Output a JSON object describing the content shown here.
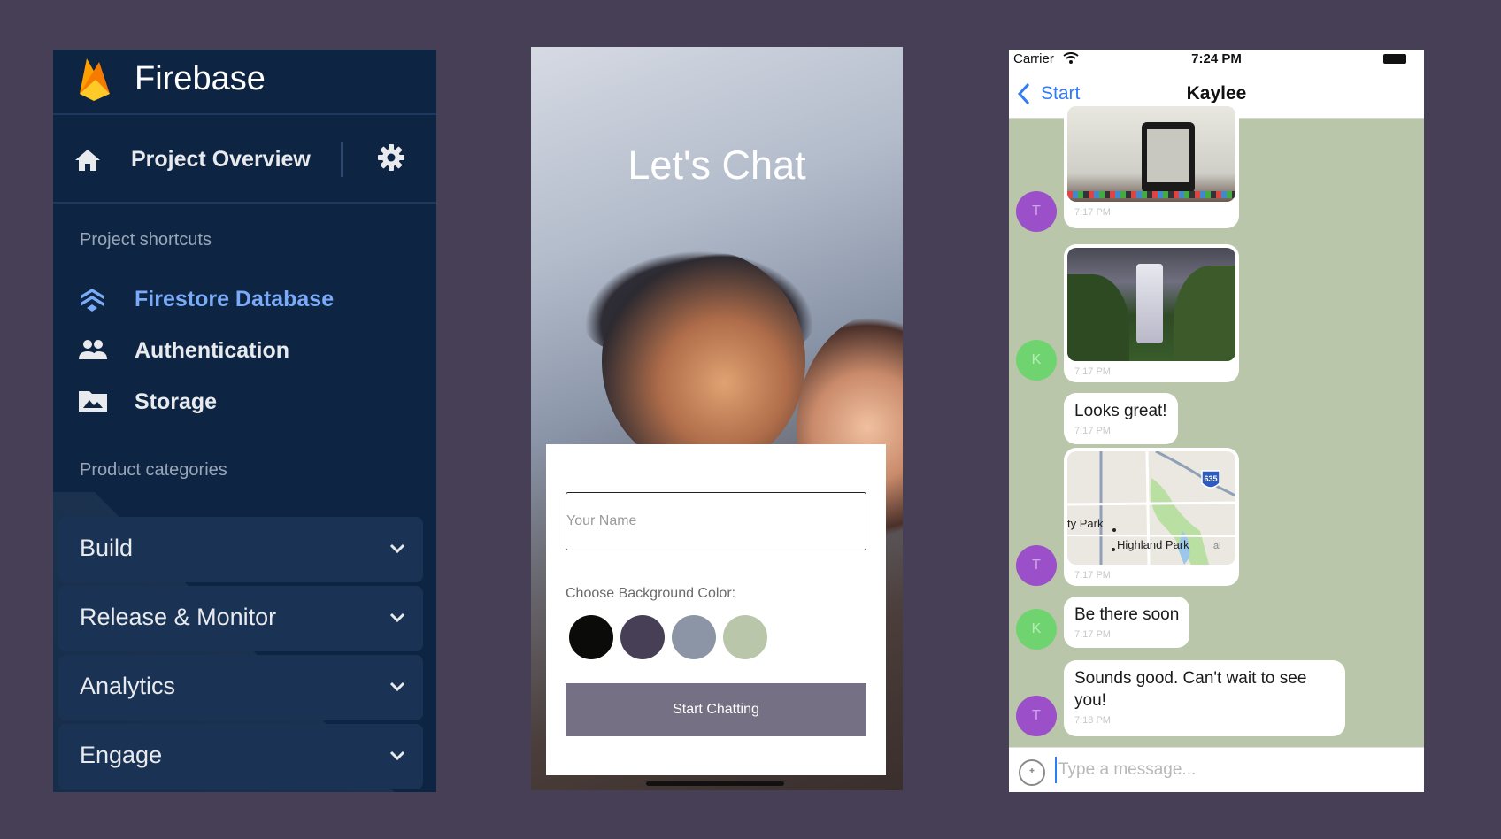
{
  "firebase": {
    "title": "Firebase",
    "overview_label": "Project Overview",
    "shortcuts_heading": "Project shortcuts",
    "shortcuts": [
      {
        "label": "Firestore Database",
        "icon": "firestore-icon"
      },
      {
        "label": "Authentication",
        "icon": "people-icon"
      },
      {
        "label": "Storage",
        "icon": "folder-image-icon"
      }
    ],
    "categories_heading": "Product categories",
    "categories": [
      {
        "label": "Build"
      },
      {
        "label": "Release & Monitor"
      },
      {
        "label": "Analytics"
      },
      {
        "label": "Engage"
      }
    ],
    "colors": {
      "background": "#0d2543",
      "active": "#7aaaf8"
    }
  },
  "start_screen": {
    "title": "Let's Chat",
    "name_placeholder": "Your Name",
    "choose_label": "Choose Background Color:",
    "swatches": [
      "#0b0c0a",
      "#463f55",
      "#8c95a6",
      "#bac6aa"
    ],
    "button_label": "Start Chatting",
    "button_color": "#757083"
  },
  "chat_screen": {
    "status": {
      "carrier": "Carrier",
      "time": "7:24 PM"
    },
    "back_label": "Start",
    "contact_name": "Kaylee",
    "background_color": "#bac6aa",
    "messages": [
      {
        "avatar": "T",
        "avatar_color": "#9b4fc8",
        "type": "image",
        "image": "laptop-photo",
        "time": "7:17 PM"
      },
      {
        "avatar": "K",
        "avatar_color": "#6fd46f",
        "type": "image",
        "image": "waterfall-photo",
        "time": "7:17 PM"
      },
      {
        "type": "text",
        "text": "Looks great!",
        "time": "7:17 PM"
      },
      {
        "avatar": "T",
        "avatar_color": "#9b4fc8",
        "type": "map",
        "map_labels": [
          "635",
          "ty Park",
          "Highland Park",
          "al"
        ],
        "time": "7:17 PM"
      },
      {
        "avatar": "K",
        "avatar_color": "#6fd46f",
        "type": "text",
        "text": "Be there soon",
        "time": "7:17 PM"
      },
      {
        "avatar": "T",
        "avatar_color": "#9b4fc8",
        "type": "text",
        "text": "Sounds good. Can't wait to see you!",
        "time": "7:18 PM"
      }
    ],
    "input_placeholder": "Type a message..."
  }
}
